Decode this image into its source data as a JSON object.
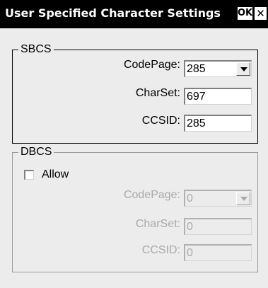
{
  "window": {
    "title": "User Specified Character Settings",
    "ok_label": "OK",
    "close_label": "✕"
  },
  "sbcs": {
    "legend": "SBCS",
    "codepage_label": "CodePage:",
    "codepage_value": "285",
    "charset_label": "CharSet:",
    "charset_value": "697",
    "ccsid_label": "CCSID:",
    "ccsid_value": "285"
  },
  "dbcs": {
    "legend": "DBCS",
    "allow_label": "Allow",
    "allow_checked": false,
    "codepage_label": "CodePage:",
    "codepage_value": "0",
    "charset_label": "CharSet:",
    "charset_value": "0",
    "ccsid_label": "CCSID:",
    "ccsid_value": "0",
    "enabled": false
  },
  "colors": {
    "title_bar": "#000000",
    "window_bg": "#ececec",
    "disabled_text": "#a9a9a9"
  }
}
